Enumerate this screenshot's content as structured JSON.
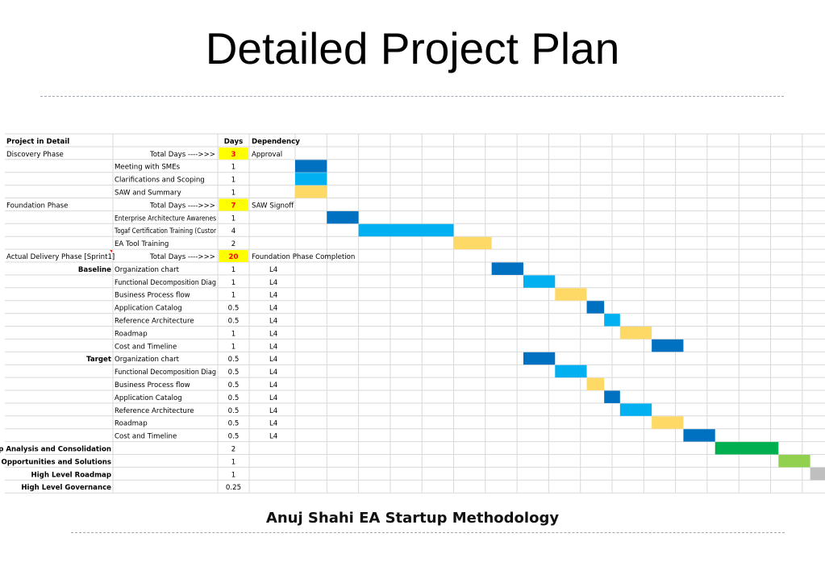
{
  "title": "Detailed Project Plan",
  "footer": "Anuj Shahi EA Startup Methodology",
  "colors": {
    "dark_blue": "#0070c0",
    "light_blue": "#00b0f0",
    "gold": "#ffd966",
    "green": "#00b050",
    "light_green": "#92d050",
    "gray": "#bfbfbf",
    "highlight_yellow": "#ffff00",
    "red_text": "#ff0000"
  },
  "chart_data": {
    "type": "gantt",
    "columns": {
      "project": "Project in Detail",
      "days": "Days",
      "dependency": "Dependency"
    },
    "rows": [
      {
        "a": "Discovery Phase",
        "b": "Total Days ---->>>",
        "days": "3",
        "dep": "Approval",
        "total": true
      },
      {
        "a": "",
        "b": "Meeting with SMEs",
        "days": "1",
        "dep": "",
        "bar": {
          "start": 0,
          "dur": 1,
          "color": "dark_blue"
        }
      },
      {
        "a": "",
        "b": "Clarifications and Scoping",
        "days": "1",
        "dep": "",
        "bar": {
          "start": 0,
          "dur": 1,
          "color": "light_blue"
        }
      },
      {
        "a": "",
        "b": "SAW and Summary",
        "days": "1",
        "dep": "",
        "bar": {
          "start": 0,
          "dur": 1,
          "color": "gold"
        }
      },
      {
        "a": "Foundation Phase",
        "b": "Total Days ---->>>",
        "days": "7",
        "dep": "SAW Signoff",
        "total": true
      },
      {
        "a": "",
        "b": "Enterprise Architecture Awarenes",
        "days": "1",
        "dep": "",
        "bar": {
          "start": 1,
          "dur": 1,
          "color": "dark_blue"
        }
      },
      {
        "a": "",
        "b": "Togaf Certification Training (Custor",
        "days": "4",
        "dep": "",
        "bar": {
          "start": 2,
          "dur": 3,
          "color": "light_blue"
        }
      },
      {
        "a": "",
        "b": "EA Tool Training",
        "days": "2",
        "dep": "",
        "bar": {
          "start": 5,
          "dur": 1.2,
          "color": "gold"
        }
      },
      {
        "a": "Actual Delivery Phase [Sprint1]",
        "b": "Total Days ---->>>",
        "days": "20",
        "dep": "Foundation Phase Completion",
        "total": true
      },
      {
        "a": "Baseline",
        "b": "Organization chart",
        "days": "1",
        "dep": "L4",
        "bar": {
          "start": 6.2,
          "dur": 1,
          "color": "dark_blue"
        }
      },
      {
        "a": "",
        "b": "Functional Decomposition Diag",
        "days": "1",
        "dep": "L4",
        "bar": {
          "start": 7.2,
          "dur": 1,
          "color": "light_blue"
        }
      },
      {
        "a": "",
        "b": "Business Process flow",
        "days": "1",
        "dep": "L4",
        "bar": {
          "start": 8.2,
          "dur": 1,
          "color": "gold"
        }
      },
      {
        "a": "",
        "b": "Application Catalog",
        "days": "0.5",
        "dep": "L4",
        "bar": {
          "start": 9.2,
          "dur": 0.55,
          "color": "dark_blue"
        }
      },
      {
        "a": "",
        "b": "Reference Architecture",
        "days": "0.5",
        "dep": "L4",
        "bar": {
          "start": 9.75,
          "dur": 0.5,
          "color": "light_blue"
        }
      },
      {
        "a": "",
        "b": "Roadmap",
        "days": "1",
        "dep": "L4",
        "bar": {
          "start": 10.25,
          "dur": 1,
          "color": "gold"
        }
      },
      {
        "a": "",
        "b": "Cost and Timeline",
        "days": "1",
        "dep": "L4",
        "bar": {
          "start": 11.25,
          "dur": 1,
          "color": "dark_blue"
        }
      },
      {
        "a": "Target",
        "b": "Organization chart",
        "days": "0.5",
        "dep": "L4",
        "bar": {
          "start": 7.2,
          "dur": 1,
          "color": "dark_blue"
        }
      },
      {
        "a": "",
        "b": "Functional Decomposition Diag",
        "days": "0.5",
        "dep": "L4",
        "bar": {
          "start": 8.2,
          "dur": 1,
          "color": "light_blue"
        }
      },
      {
        "a": "",
        "b": "Business Process flow",
        "days": "0.5",
        "dep": "L4",
        "bar": {
          "start": 9.2,
          "dur": 0.55,
          "color": "gold"
        }
      },
      {
        "a": "",
        "b": "Application Catalog",
        "days": "0.5",
        "dep": "L4",
        "bar": {
          "start": 9.75,
          "dur": 0.5,
          "color": "dark_blue"
        }
      },
      {
        "a": "",
        "b": "Reference Architecture",
        "days": "0.5",
        "dep": "L4",
        "bar": {
          "start": 10.25,
          "dur": 1,
          "color": "light_blue"
        }
      },
      {
        "a": "",
        "b": "Roadmap",
        "days": "0.5",
        "dep": "L4",
        "bar": {
          "start": 11.25,
          "dur": 1,
          "color": "gold"
        }
      },
      {
        "a": "",
        "b": "Cost and Timeline",
        "days": "0.5",
        "dep": "L4",
        "bar": {
          "start": 12.25,
          "dur": 1,
          "color": "dark_blue"
        }
      },
      {
        "a": "Gap Analysis and Consolidation",
        "b": "",
        "days": "2",
        "dep": "",
        "bold_a": true,
        "bar": {
          "start": 13.25,
          "dur": 2,
          "color": "green"
        }
      },
      {
        "a": "Opportunities and Solutions",
        "b": "",
        "days": "1",
        "dep": "",
        "bold_a": true,
        "bar": {
          "start": 15.25,
          "dur": 1,
          "color": "light_green"
        }
      },
      {
        "a": "High Level Roadmap",
        "b": "",
        "days": "1",
        "dep": "",
        "bold_a": true,
        "bar": {
          "start": 16.25,
          "dur": 1,
          "color": "gray"
        }
      },
      {
        "a": "High Level Governance",
        "b": "",
        "days": "0.25",
        "dep": "",
        "bold_a": true
      }
    ]
  }
}
